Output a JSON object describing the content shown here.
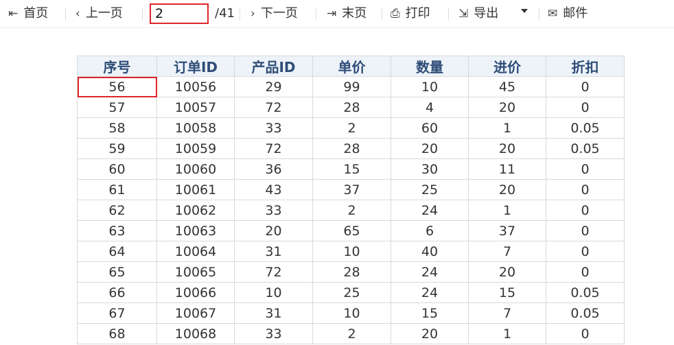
{
  "toolbar": {
    "first": "首页",
    "prev": "上一页",
    "page_input": "2",
    "total_pages": "/41",
    "next": "下一页",
    "last": "末页",
    "print": "打印",
    "export": "导出",
    "mail": "邮件",
    "icons": {
      "first": "⇤",
      "prev": "‹",
      "next": "›",
      "last": "⇥",
      "print": "⎙",
      "export": "⇲",
      "mail": "✉"
    }
  },
  "table": {
    "headers": [
      "序号",
      "订单ID",
      "产品ID",
      "单价",
      "数量",
      "进价",
      "折扣"
    ],
    "rows": [
      [
        "56",
        "10056",
        "29",
        "99",
        "10",
        "45",
        "0"
      ],
      [
        "57",
        "10057",
        "72",
        "28",
        "4",
        "20",
        "0"
      ],
      [
        "58",
        "10058",
        "33",
        "2",
        "60",
        "1",
        "0.05"
      ],
      [
        "59",
        "10059",
        "72",
        "28",
        "20",
        "20",
        "0.05"
      ],
      [
        "60",
        "10060",
        "36",
        "15",
        "30",
        "11",
        "0"
      ],
      [
        "61",
        "10061",
        "43",
        "37",
        "25",
        "20",
        "0"
      ],
      [
        "62",
        "10062",
        "33",
        "2",
        "24",
        "1",
        "0"
      ],
      [
        "63",
        "10063",
        "20",
        "65",
        "6",
        "37",
        "0"
      ],
      [
        "64",
        "10064",
        "31",
        "10",
        "40",
        "7",
        "0"
      ],
      [
        "65",
        "10065",
        "72",
        "28",
        "24",
        "20",
        "0"
      ],
      [
        "66",
        "10066",
        "10",
        "25",
        "24",
        "15",
        "0.05"
      ],
      [
        "67",
        "10067",
        "31",
        "10",
        "15",
        "7",
        "0.05"
      ],
      [
        "68",
        "10068",
        "33",
        "2",
        "20",
        "1",
        "0"
      ]
    ]
  },
  "colors": {
    "highlight": "#e0242b",
    "header_bg": "#edf3f9",
    "header_text": "#2f4d77"
  }
}
